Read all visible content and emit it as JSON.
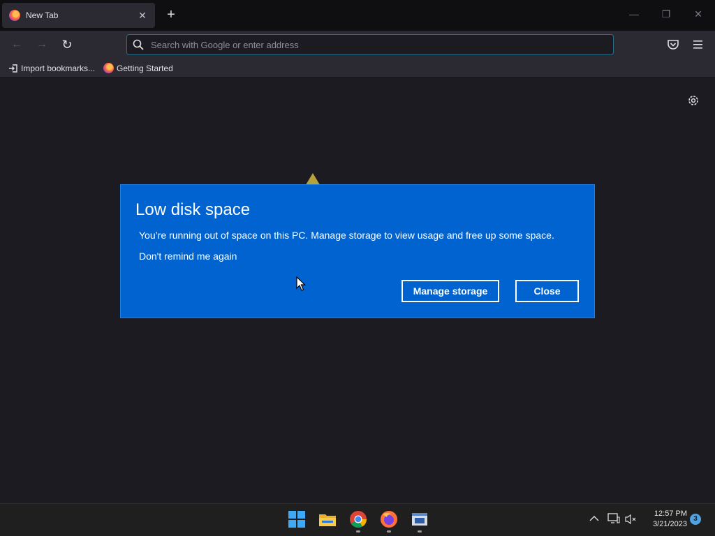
{
  "browser": {
    "tab": {
      "title": "New Tab",
      "close_glyph": "✕"
    },
    "new_tab_glyph": "+",
    "window_controls": {
      "minimize": "—",
      "restore": "❐",
      "close": "✕"
    },
    "nav": {
      "back": "←",
      "forward": "→",
      "reload": "↻"
    },
    "urlbar": {
      "placeholder": "Search with Google or enter address",
      "value": ""
    },
    "bookmarks": [
      {
        "label": "Import bookmarks...",
        "icon": "import-icon"
      },
      {
        "label": "Getting Started",
        "icon": "firefox-icon"
      }
    ]
  },
  "dialog": {
    "title": "Low disk space",
    "message": "You’re running out of space on this PC. Manage storage to view usage and free up some space.",
    "remind_link": "Don't remind me again",
    "primary_button": "Manage storage",
    "secondary_button": "Close",
    "colors": {
      "background": "#0063cf",
      "text": "#ffffff"
    }
  },
  "taskbar": {
    "apps": [
      "start-icon",
      "file-explorer-icon",
      "chrome-icon",
      "firefox-icon",
      "app-window-icon"
    ],
    "clock": {
      "time": "12:57 PM",
      "date": "3/21/2023"
    },
    "notification_count": "3"
  }
}
